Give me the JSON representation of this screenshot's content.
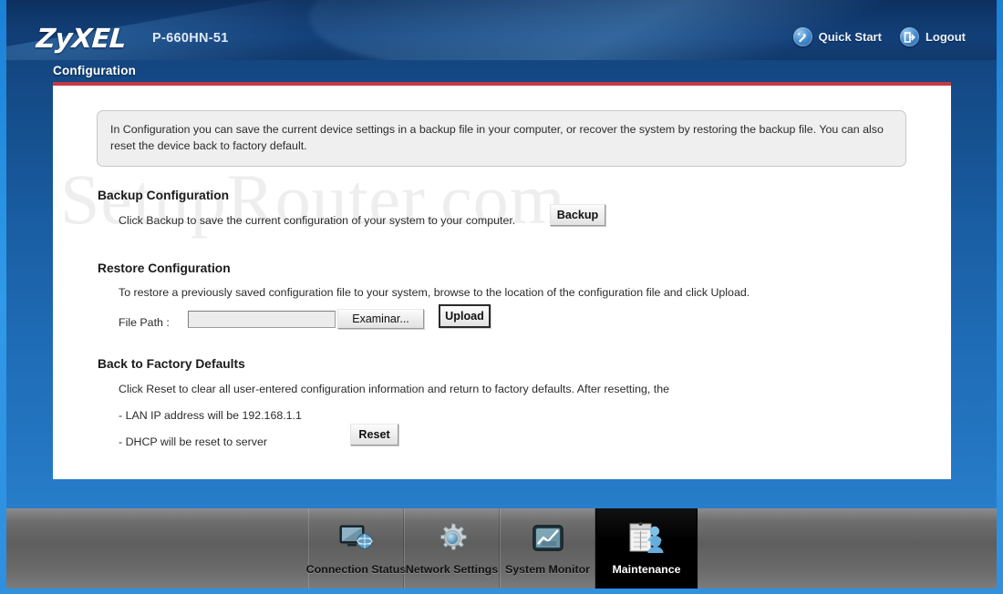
{
  "header": {
    "logo": "ZyXEL",
    "model": "P-660HN-51",
    "quick_start_label": "Quick Start",
    "quick_start_icon": "magic-wand-icon",
    "logout_label": "Logout",
    "logout_icon": "logout-door-icon"
  },
  "page": {
    "section_title": "Configuration",
    "watermark": "SetupRouter.com",
    "accent_red": "#c33b44",
    "panel_bg": "#ffffff"
  },
  "info": {
    "text": "In Configuration you can save the current device settings in a backup file in your computer, or recover the system by restoring the backup file. You can also reset the device back to factory default."
  },
  "backup": {
    "heading": "Backup Configuration",
    "description": "Click Backup to save the current configuration of your system to your computer.",
    "button_label": "Backup"
  },
  "restore": {
    "heading": "Restore Configuration",
    "description": "To restore a previously saved configuration file to your system, browse to the location of the configuration file and click Upload.",
    "file_path_label": "File Path :",
    "file_path_value": "",
    "file_path_placeholder": "",
    "browse_label": "Examinar...",
    "upload_label": "Upload"
  },
  "factory": {
    "heading": "Back to Factory Defaults",
    "description": "Click Reset to clear all user-entered configuration information and return to factory defaults. After resetting, the",
    "line_lan": "- LAN IP address will be 192.168.1.1",
    "line_dhcp": "- DHCP will be reset to server",
    "reset_label": "Reset"
  },
  "nav": {
    "tabs": [
      {
        "label": "Connection Status",
        "icon": "monitor-globe-icon",
        "active": false
      },
      {
        "label": "Network Settings",
        "icon": "gear-icon",
        "active": false
      },
      {
        "label": "System Monitor",
        "icon": "chart-line-icon",
        "active": false
      },
      {
        "label": "Maintenance",
        "icon": "clipboard-people-icon",
        "active": true
      }
    ]
  }
}
